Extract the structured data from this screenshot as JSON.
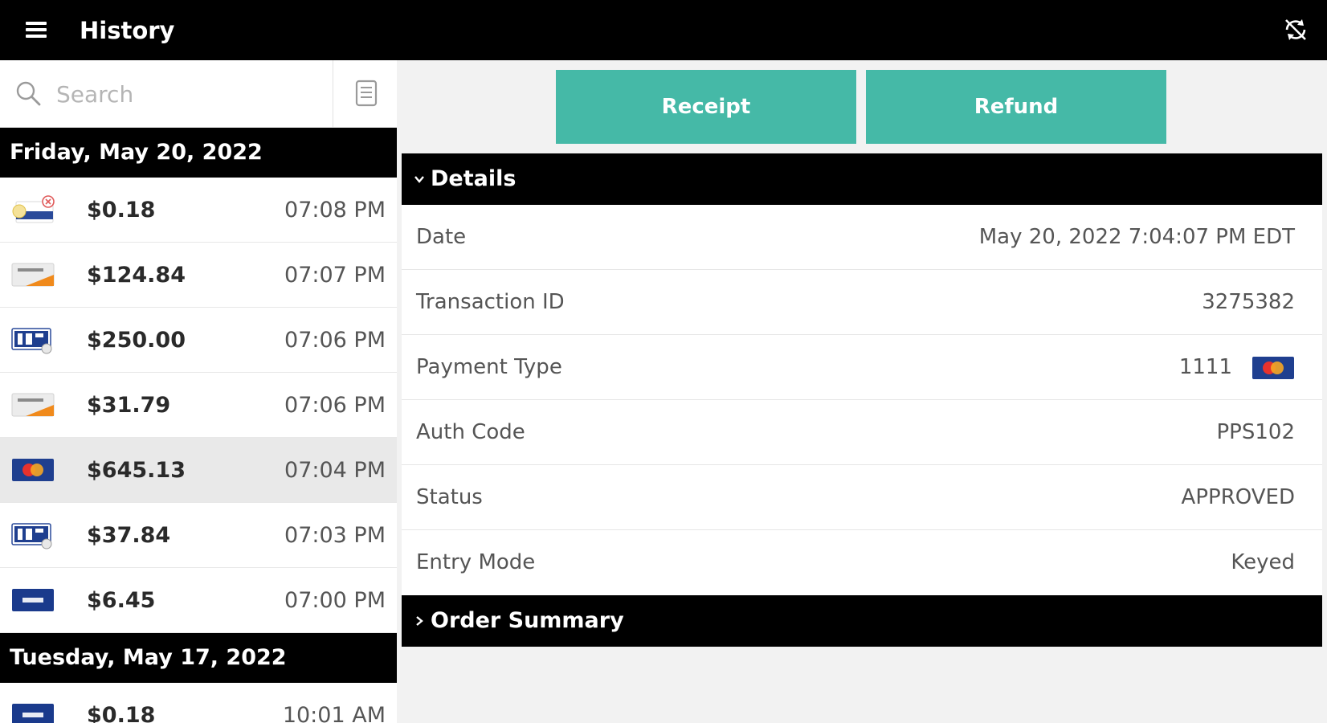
{
  "app": {
    "title": "History"
  },
  "search": {
    "placeholder": "Search"
  },
  "groups": [
    {
      "date": "Friday, May 20, 2022",
      "transactions": [
        {
          "amount": "$0.18",
          "time": "07:08 PM",
          "card": "contactless-card"
        },
        {
          "amount": "$124.84",
          "time": "07:07 PM",
          "card": "discover"
        },
        {
          "amount": "$250.00",
          "time": "07:06 PM",
          "card": "ebt"
        },
        {
          "amount": "$31.79",
          "time": "07:06 PM",
          "card": "discover"
        },
        {
          "amount": "$645.13",
          "time": "07:04 PM",
          "card": "mastercard",
          "selected": true
        },
        {
          "amount": "$37.84",
          "time": "07:03 PM",
          "card": "ebt"
        },
        {
          "amount": "$6.45",
          "time": "07:00 PM",
          "card": "visa"
        }
      ]
    },
    {
      "date": "Tuesday, May 17, 2022",
      "transactions": [
        {
          "amount": "$0.18",
          "time": "10:01 AM",
          "card": "visa"
        }
      ]
    }
  ],
  "actions": {
    "receipt": "Receipt",
    "refund": "Refund"
  },
  "details": {
    "header": "Details",
    "rows": [
      {
        "label": "Date",
        "value": "May 20, 2022 7:04:07 PM EDT"
      },
      {
        "label": "Transaction ID",
        "value": "3275382"
      },
      {
        "label": "Payment Type",
        "value": "1111",
        "card": "mastercard"
      },
      {
        "label": "Auth Code",
        "value": "PPS102"
      },
      {
        "label": "Status",
        "value": "APPROVED"
      },
      {
        "label": "Entry Mode",
        "value": "Keyed"
      }
    ]
  },
  "order_summary": {
    "header": "Order Summary"
  },
  "colors": {
    "accent": "#45b9a7",
    "header": "#000000",
    "selected_row": "#e9e9e9"
  }
}
